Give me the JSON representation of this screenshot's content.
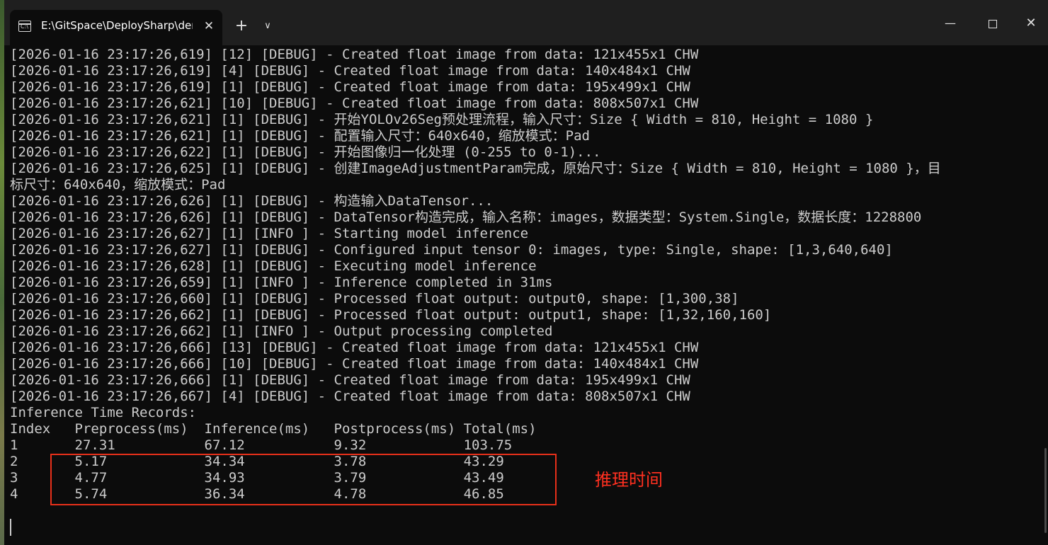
{
  "window": {
    "tab_title": "E:\\GitSpace\\DeploySharp\\dem",
    "tab_icon": "terminal-icon",
    "new_tab_label": "+",
    "dropdown_label": "∨",
    "close_tab_label": "✕",
    "minimize_label": "—",
    "close_window_label": "✕"
  },
  "terminal": {
    "lines": [
      "[2026-01-16 23:17:26,619] [12] [DEBUG] - Created float image from data: 121x455x1 CHW",
      "[2026-01-16 23:17:26,619] [4] [DEBUG] - Created float image from data: 140x484x1 CHW",
      "[2026-01-16 23:17:26,619] [1] [DEBUG] - Created float image from data: 195x499x1 CHW",
      "[2026-01-16 23:17:26,621] [10] [DEBUG] - Created float image from data: 808x507x1 CHW",
      "[2026-01-16 23:17:26,621] [1] [DEBUG] - 开始YOLOv26Seg预处理流程，输入尺寸：Size { Width = 810, Height = 1080 }",
      "[2026-01-16 23:17:26,621] [1] [DEBUG] - 配置输入尺寸：640x640，缩放模式：Pad",
      "[2026-01-16 23:17:26,622] [1] [DEBUG] - 开始图像归一化处理 (0-255 to 0-1)...",
      "[2026-01-16 23:17:26,625] [1] [DEBUG] - 创建ImageAdjustmentParam完成，原始尺寸：Size { Width = 810, Height = 1080 }，目",
      "标尺寸：640x640，缩放模式：Pad",
      "[2026-01-16 23:17:26,626] [1] [DEBUG] - 构造输入DataTensor...",
      "[2026-01-16 23:17:26,626] [1] [DEBUG] - DataTensor构造完成，输入名称：images，数据类型：System.Single，数据长度：1228800",
      "[2026-01-16 23:17:26,627] [1] [INFO ] - Starting model inference",
      "[2026-01-16 23:17:26,627] [1] [DEBUG] - Configured input tensor 0: images, type: Single, shape: [1,3,640,640]",
      "[2026-01-16 23:17:26,628] [1] [DEBUG] - Executing model inference",
      "[2026-01-16 23:17:26,659] [1] [INFO ] - Inference completed in 31ms",
      "[2026-01-16 23:17:26,660] [1] [DEBUG] - Processed float output: output0, shape: [1,300,38]",
      "[2026-01-16 23:17:26,662] [1] [DEBUG] - Processed float output: output1, shape: [1,32,160,160]",
      "[2026-01-16 23:17:26,662] [1] [INFO ] - Output processing completed",
      "[2026-01-16 23:17:26,666] [13] [DEBUG] - Created float image from data: 121x455x1 CHW",
      "[2026-01-16 23:17:26,666] [10] [DEBUG] - Created float image from data: 140x484x1 CHW",
      "[2026-01-16 23:17:26,666] [1] [DEBUG] - Created float image from data: 195x499x1 CHW",
      "[2026-01-16 23:17:26,667] [4] [DEBUG] - Created float image from data: 808x507x1 CHW",
      "Inference Time Records:",
      "Index   Preprocess(ms)  Inference(ms)   Postprocess(ms) Total(ms)",
      "1       27.31           67.12           9.32            103.75",
      "2       5.17            34.34           3.78            43.29",
      "3       4.77            34.93           3.79            43.49",
      "4       5.74            36.34           4.78            46.85"
    ]
  },
  "annotation": {
    "text": "推理时间",
    "color": "#ff3020"
  },
  "colors": {
    "background": "#0c0c0c",
    "titlebar": "#1f1f1f",
    "text": "#cccccc",
    "highlight": "#e8301a"
  }
}
